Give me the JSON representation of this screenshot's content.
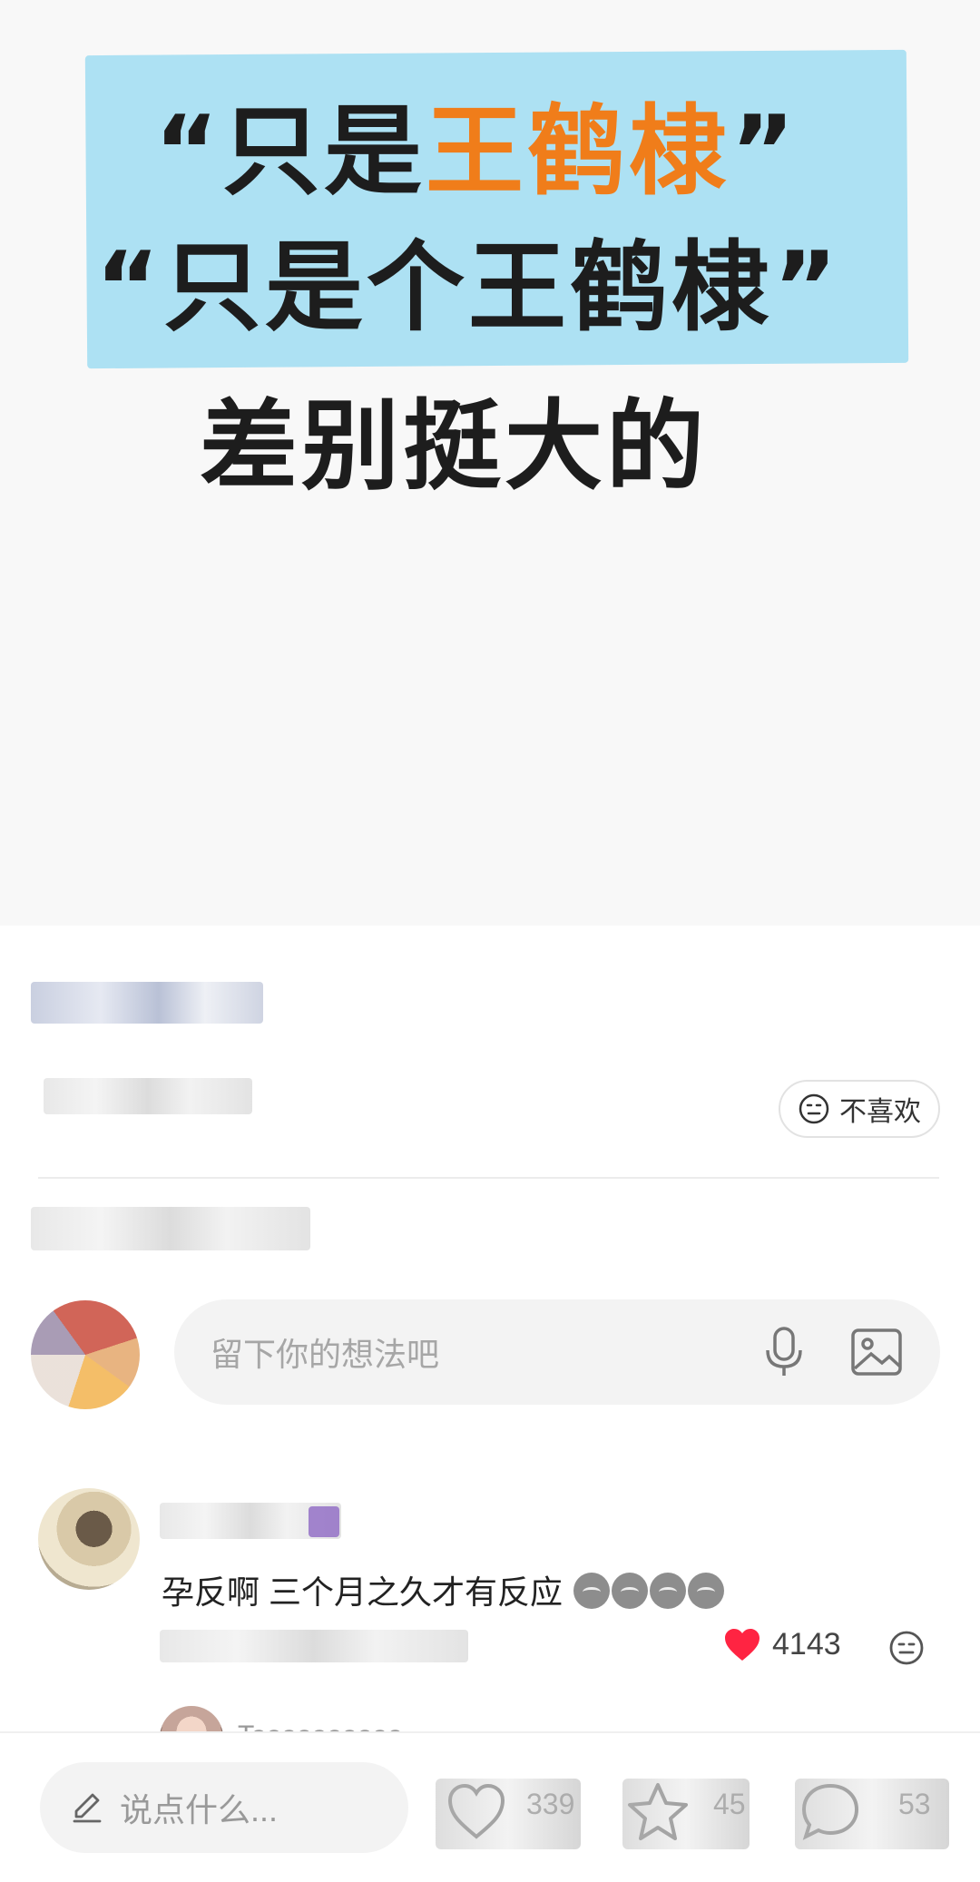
{
  "poster": {
    "line1_pre": "“只是",
    "line1_accent": "王鹤棣",
    "line1_post": "”",
    "line2": "“只是个王鹤棣”",
    "line3": "差别挺大的",
    "highlight_color": "#a9dff2",
    "accent_color": "#f07d1a"
  },
  "feedback": {
    "dislike_label": "不喜欢"
  },
  "composer": {
    "placeholder": "留下你的想法吧"
  },
  "comments": [
    {
      "text": "孕反啊 三个月之久才有反应",
      "emoji_count": 4,
      "likes": "4143"
    }
  ],
  "reply_preview": {
    "username": "Taoaoaoaoao"
  },
  "bottom_bar": {
    "input_placeholder": "说点什么...",
    "like_count": "339",
    "collect_count": "45",
    "comment_count": "53"
  },
  "colors": {
    "like_red": "#ff2442",
    "input_bg": "#f3f3f3"
  }
}
